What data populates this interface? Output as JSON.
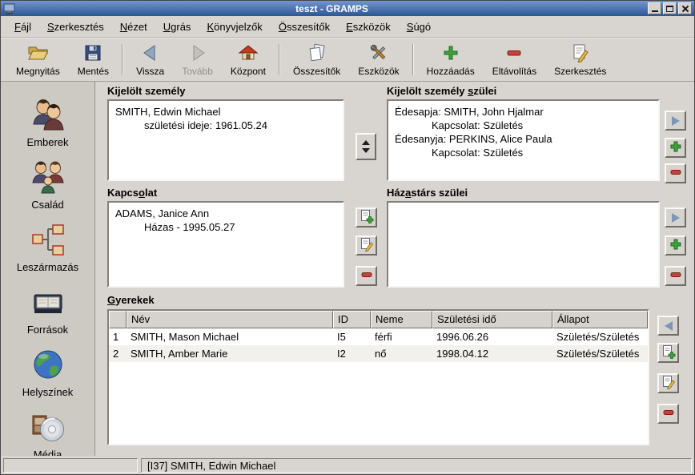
{
  "window": {
    "title": "teszt - GRAMPS"
  },
  "menubar": {
    "items": [
      {
        "pre": "",
        "accel": "F",
        "post": "ájl"
      },
      {
        "pre": "",
        "accel": "S",
        "post": "zerkesztés"
      },
      {
        "pre": "",
        "accel": "N",
        "post": "ézet"
      },
      {
        "pre": "",
        "accel": "U",
        "post": "grás"
      },
      {
        "pre": "",
        "accel": "K",
        "post": "önyvjelzők"
      },
      {
        "pre": "",
        "accel": "Ö",
        "post": "sszesítők"
      },
      {
        "pre": "",
        "accel": "E",
        "post": "szközök"
      },
      {
        "pre": "",
        "accel": "S",
        "post": "úgó"
      }
    ]
  },
  "toolbar": {
    "buttons": [
      {
        "label": "Megnyitás",
        "icon": "folder-open-icon"
      },
      {
        "label": "Mentés",
        "icon": "floppy-icon"
      },
      {
        "label": "Vissza",
        "icon": "arrow-left-icon"
      },
      {
        "label": "Tovább",
        "icon": "arrow-right-icon",
        "disabled": true
      },
      {
        "label": "Központ",
        "icon": "home-icon"
      },
      {
        "label": "Összesítők",
        "icon": "reports-icon"
      },
      {
        "label": "Eszközök",
        "icon": "tools-icon"
      },
      {
        "label": "Hozzáadás",
        "icon": "plus-icon"
      },
      {
        "label": "Eltávolítás",
        "icon": "minus-icon"
      },
      {
        "label": "Szerkesztés",
        "icon": "edit-icon"
      }
    ]
  },
  "sidebar": {
    "items": [
      {
        "label": "Emberek",
        "icon": "people-icon"
      },
      {
        "label": "Család",
        "icon": "family-icon"
      },
      {
        "label": "Leszármazás",
        "icon": "pedigree-icon"
      },
      {
        "label": "Források",
        "icon": "books-icon"
      },
      {
        "label": "Helyszínek",
        "icon": "globe-icon"
      },
      {
        "label": "Média",
        "icon": "media-icon"
      }
    ]
  },
  "main": {
    "selected_person": {
      "label": {
        "pre": "Kijelölt személy",
        "accel": "",
        "post": ""
      },
      "name": "SMITH, Edwin Michael",
      "birth_line": "születési ideje: 1961.05.24"
    },
    "parents": {
      "label": {
        "pre": "Kijelölt személy ",
        "accel": "s",
        "post": "zülei"
      },
      "lines": [
        "Édesapja: SMITH, John Hjalmar",
        "Kapcsolat: Születés",
        "Édesanyja: PERKINS, Alice Paula",
        "Kapcsolat: Születés"
      ]
    },
    "relationship": {
      "label": {
        "pre": "Kapcs",
        "accel": "o",
        "post": "lat"
      },
      "name": "ADAMS, Janice Ann",
      "detail": "Házas - 1995.05.27"
    },
    "spouse_parents": {
      "label": {
        "pre": "Ház",
        "accel": "a",
        "post": "stárs szülei"
      }
    },
    "children": {
      "label": {
        "pre": "",
        "accel": "G",
        "post": "yerekek"
      },
      "columns": [
        "",
        "Név",
        "ID",
        "Neme",
        "Születési idő",
        "Állapot"
      ],
      "rows": [
        [
          "1",
          "SMITH, Mason Michael",
          "I5",
          "férfi",
          "1996.06.26",
          "Születés/Születés"
        ],
        [
          "2",
          "SMITH, Amber Marie",
          "I2",
          "nő",
          "1998.04.12",
          "Születés/Születés"
        ]
      ]
    }
  },
  "statusbar": {
    "text": "[I37] SMITH, Edwin Michael"
  },
  "colors": {
    "titlebar_blue": "#3a67a8",
    "plus_green": "#3ea13e",
    "minus_red": "#c8403a",
    "nav_arrow_blue": "#7d96b5",
    "background_gray": "#d8d4cf"
  }
}
